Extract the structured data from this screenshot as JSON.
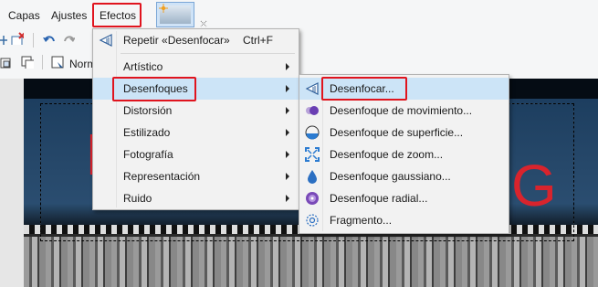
{
  "menubar": {
    "items": [
      "Capas",
      "Ajustes",
      "Efectos"
    ]
  },
  "toolbar": {
    "partial_label": "Norm"
  },
  "photo": {
    "sign_letters": [
      "I",
      "G"
    ]
  },
  "effects_menu": {
    "repeat": {
      "label": "Repetir «Desenfocar»",
      "shortcut": "Ctrl+F"
    },
    "items": [
      {
        "label": "Artístico"
      },
      {
        "label": "Desenfoques"
      },
      {
        "label": "Distorsión"
      },
      {
        "label": "Estilizado"
      },
      {
        "label": "Fotografía"
      },
      {
        "label": "Representación"
      },
      {
        "label": "Ruido"
      }
    ]
  },
  "blur_submenu": {
    "items": [
      {
        "label": "Desenfocar...",
        "icon": "triangle-blur-icon"
      },
      {
        "label": "Desenfoque de movimiento...",
        "icon": "motion-blur-icon"
      },
      {
        "label": "Desenfoque de superficie...",
        "icon": "surface-blur-icon"
      },
      {
        "label": "Desenfoque de zoom...",
        "icon": "zoom-blur-icon"
      },
      {
        "label": "Desenfoque gaussiano...",
        "icon": "gaussian-drop-icon"
      },
      {
        "label": "Desenfoque radial...",
        "icon": "radial-blur-icon"
      },
      {
        "label": "Fragmento...",
        "icon": "fragment-icon"
      }
    ]
  },
  "colors": {
    "highlight_red": "#e0141e",
    "menu_hover": "#cce4f7",
    "sign_red": "#d8242d"
  }
}
